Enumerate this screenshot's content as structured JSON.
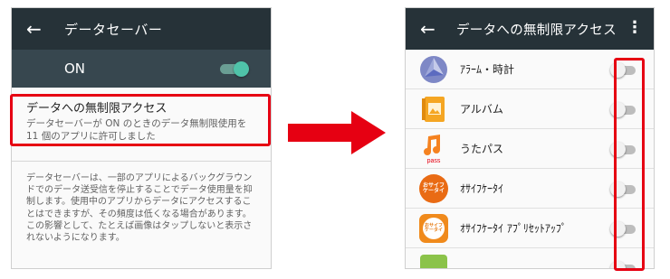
{
  "left_screen": {
    "appbar_title": "データセーバー",
    "switch_label": "ON",
    "switch_state": "on",
    "item_title": "データへの無制限アクセス",
    "item_summary": "データセーバーが ON のときのデータ無制限使用を 11 個のアプリに許可しました",
    "description": "データセーバーは、一部のアプリによるバックグラウンドでのデータ送受信を停止することでデータ使用量を抑制します。使用中のアプリからデータにアクセスすることはできますが、その頻度は低くなる場合があります。この影響として、たとえば画像はタップしないと表示されないようになります。"
  },
  "right_screen": {
    "appbar_title": "データへの無制限アクセス",
    "apps": [
      {
        "name": "ｱﾗｰﾑ・時計",
        "icon": "clock-icon",
        "enabled": false
      },
      {
        "name": "アルバム",
        "icon": "album-icon",
        "enabled": false
      },
      {
        "name": "うたパス",
        "icon": "utapass-icon",
        "enabled": false
      },
      {
        "name": "ｵｻｲﾌｹｰﾀｲ",
        "icon": "osaifu-keitai-icon",
        "enabled": false
      },
      {
        "name": "ｵｻｲﾌｹｰﾀｲ ｱﾌﾟﾘｾｯﾄｱｯﾌﾟ",
        "icon": "osaifu-setup-icon",
        "enabled": false
      }
    ],
    "icon_texts": {
      "utapass": "pass",
      "osaifu": "おサイフ\nケータイ"
    }
  },
  "colors": {
    "appbar": "#263238",
    "switchbar": "#37474f",
    "highlight": "#e60012",
    "toggle_on": "#4fc3a9"
  }
}
